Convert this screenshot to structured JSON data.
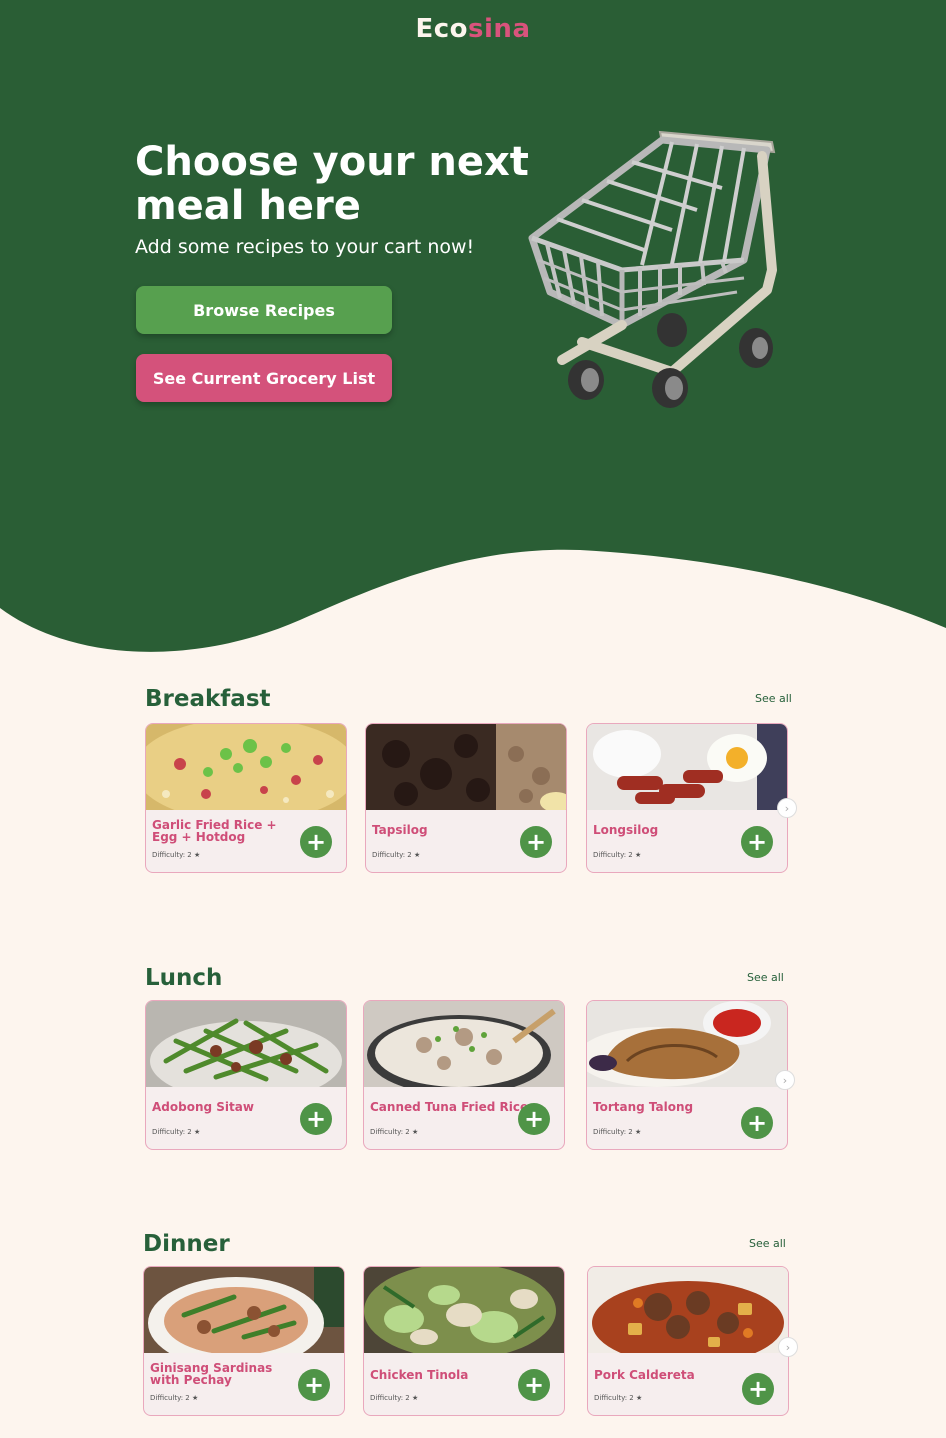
{
  "header": {
    "logo_part1": "Eco",
    "logo_part2": "sina"
  },
  "hero": {
    "title_line1": "Choose your next",
    "title_line2": "meal here",
    "subtitle": "Add some recipes to your cart now!",
    "browse_label": "Browse Recipes",
    "grocery_label": "See Current Grocery List"
  },
  "colors": {
    "hero_green": "#2a5e35",
    "page_bg": "#fdf5ee",
    "accent_pink": "#d4527b",
    "button_green": "#57a04f"
  },
  "sections": [
    {
      "title": "Breakfast",
      "see_all": "See all",
      "cards": [
        {
          "name": "Garlic Fried Rice + Egg + Hotdog",
          "difficulty": "Difficulty: 2 ★"
        },
        {
          "name": "Tapsilog",
          "difficulty": "Difficulty: 2 ★"
        },
        {
          "name": "Longsilog",
          "difficulty": "Difficulty: 2 ★"
        }
      ]
    },
    {
      "title": "Lunch",
      "see_all": "See all",
      "cards": [
        {
          "name": "Adobong Sitaw",
          "difficulty": "Difficulty: 2 ★"
        },
        {
          "name": "Canned Tuna Fried Rice",
          "difficulty": "Difficulty: 2 ★"
        },
        {
          "name": "Tortang Talong",
          "difficulty": "Difficulty: 2 ★"
        }
      ]
    },
    {
      "title": "Dinner",
      "see_all": "See all",
      "cards": [
        {
          "name": "Ginisang Sardinas with Pechay",
          "difficulty": "Difficulty: 2 ★"
        },
        {
          "name": "Chicken Tinola",
          "difficulty": "Difficulty: 2 ★"
        },
        {
          "name": "Pork Caldereta",
          "difficulty": "Difficulty: 2 ★"
        }
      ]
    }
  ],
  "icons": {
    "add": "plus-icon",
    "next": "chevron-right-icon",
    "cart": "shopping-cart-icon"
  }
}
